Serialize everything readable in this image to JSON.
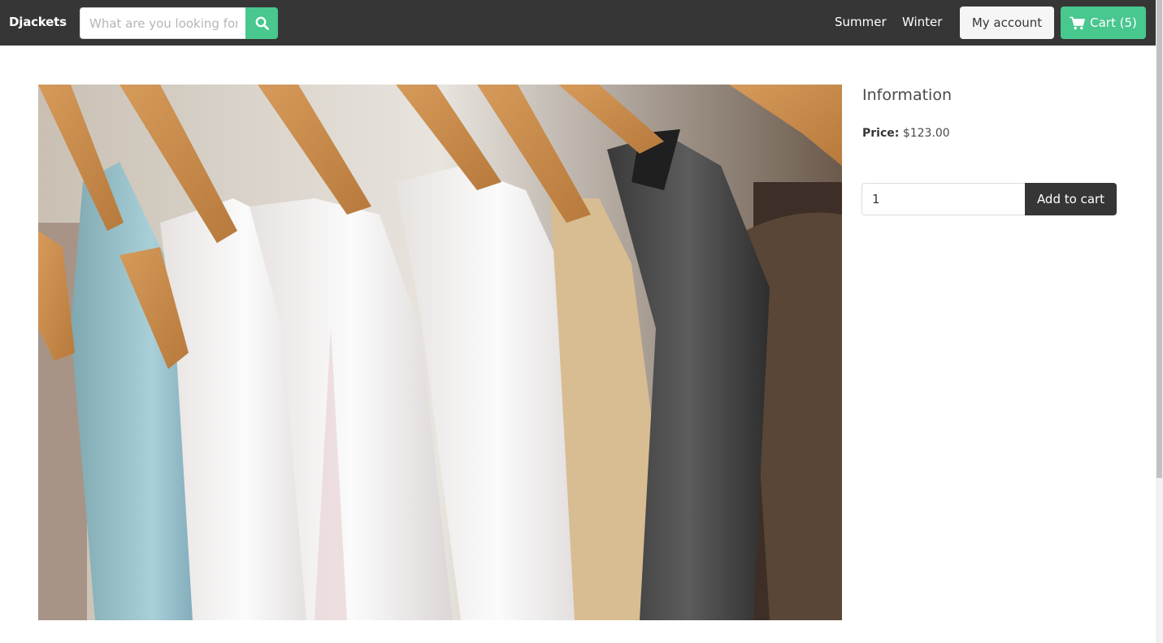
{
  "navbar": {
    "brand": "Djackets",
    "search": {
      "placeholder": "What are you looking for?"
    },
    "links": [
      {
        "label": "Summer"
      },
      {
        "label": "Winter"
      }
    ],
    "account_label": "My account",
    "cart_label": "Cart (5)"
  },
  "product": {
    "image_icon": "clothes-rack-photo",
    "info_title": "Information",
    "price_label": "Price:",
    "price_value": "$123.00",
    "quantity": "1",
    "add_to_cart_label": "Add to cart"
  },
  "colors": {
    "navbar": "#363636",
    "accent": "#48c78e",
    "dark_button": "#363636",
    "light_button": "#f5f5f5"
  }
}
